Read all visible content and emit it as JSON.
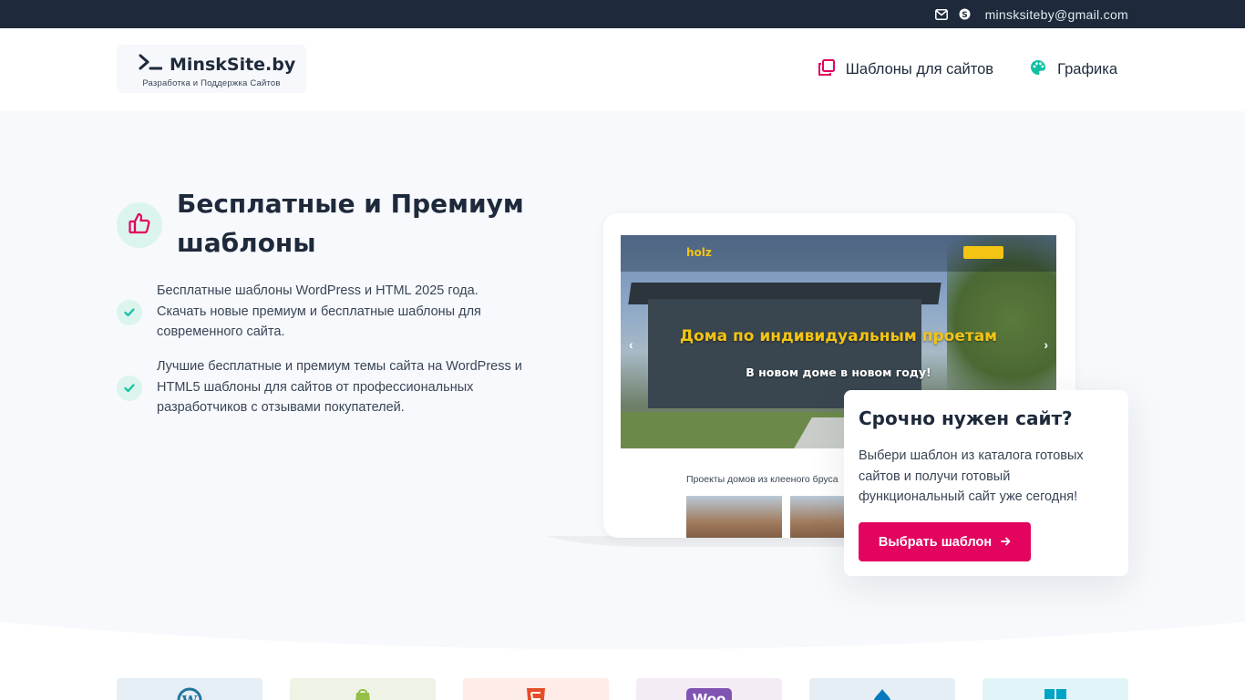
{
  "topbar": {
    "icons": [
      "envelope-icon",
      "skype-icon"
    ],
    "email": "minsksiteby@gmail.com"
  },
  "header": {
    "logo": {
      "icon": "terminal-prompt-icon",
      "name": "MinskSite.by",
      "tagline": "Разработка и Поддержка Сайтов"
    },
    "nav": [
      {
        "label": "Шаблоны для сайтов",
        "icon": "copy-icon",
        "icon_color": "#e2045e"
      },
      {
        "label": "Графика",
        "icon": "palette-icon",
        "icon_color": "#0fc1a1"
      }
    ]
  },
  "hero": {
    "badge_icon": "thumbs-up-icon",
    "title": "Бесплатные и Премиум шаблоны",
    "bullets": [
      "Бесплатные шаблоны WordPress и HTML 2025 года. Скачать новые премиум и бесплатные шаблоны для современного сайта.",
      "Лучшие бесплатные и премиум темы сайта на WordPress и HTML5 шаблоны для сайтов от профессиональных разработчиков с отзывами покупателей."
    ],
    "mockup": {
      "brand": "holz",
      "headline": "Дома по индивидуальным проетам",
      "subheadline": "В новом доме в новом году!",
      "section_title": "Проекты домов из клееного бруса"
    }
  },
  "card": {
    "title": "Срочно нужен сайт?",
    "text": "Выбери шаблон из каталога готовых сайтов и получи готовый функциональный сайт уже сегодня!",
    "button": "Выбрать шаблон"
  },
  "platforms": [
    {
      "name": "wordpress-icon",
      "bg": "#e6eef6",
      "color": "#21759b"
    },
    {
      "name": "shopify-icon",
      "bg": "#eef3e6",
      "color": "#95bf47"
    },
    {
      "name": "html5-icon",
      "bg": "#fdece7",
      "color": "#e44d26"
    },
    {
      "name": "woocommerce-icon",
      "bg": "#f3ecf5",
      "color": "#7f54b3"
    },
    {
      "name": "drupal-icon",
      "bg": "#e6eef5",
      "color": "#0678be"
    },
    {
      "name": "windows-icon",
      "bg": "#e3f4f8",
      "color": "#00a4c6"
    }
  ],
  "colors": {
    "dark": "#1e2a3b",
    "accent": "#e2045e",
    "teal": "#0fc1a1",
    "hero_bg": "#f7f9fc"
  }
}
